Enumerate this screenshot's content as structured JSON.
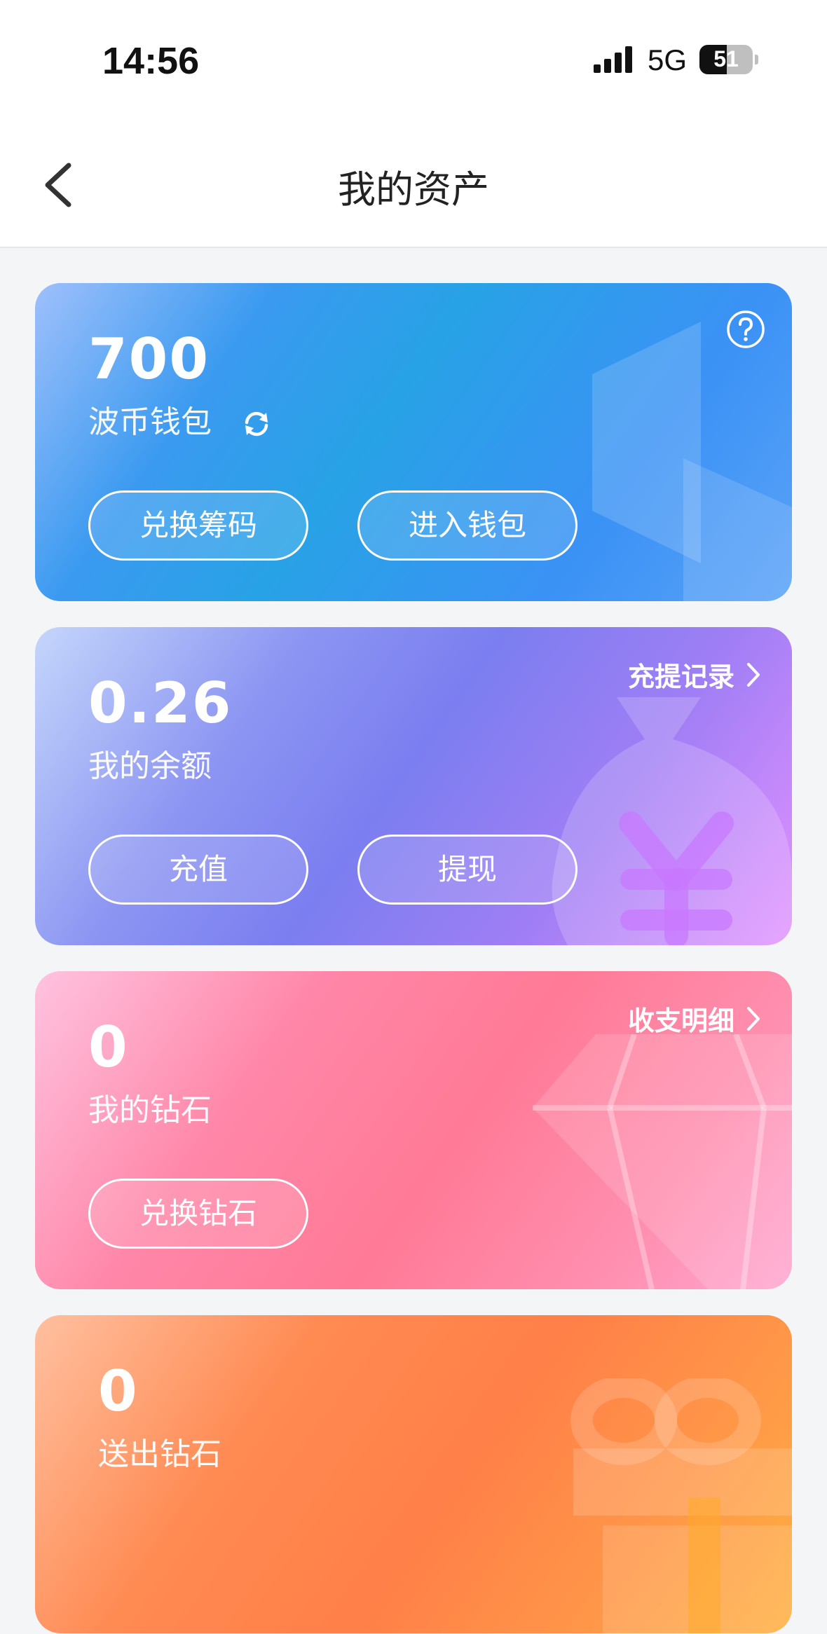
{
  "status_bar": {
    "time": "14:56",
    "network": "5G",
    "battery": "51"
  },
  "nav": {
    "title": "我的资产"
  },
  "cards": {
    "wallet": {
      "value": "700",
      "label": "波币钱包",
      "buttons": [
        "兑换筹码",
        "进入钱包"
      ]
    },
    "balance": {
      "value": "0.26",
      "label": "我的余额",
      "link": "充提记录",
      "buttons": [
        "充值",
        "提现"
      ]
    },
    "diamond": {
      "value": "0",
      "label": "我的钻石",
      "link": "收支明细",
      "buttons": [
        "兑换钻石"
      ]
    },
    "sent": {
      "value": "0",
      "label": "送出钻石"
    }
  }
}
